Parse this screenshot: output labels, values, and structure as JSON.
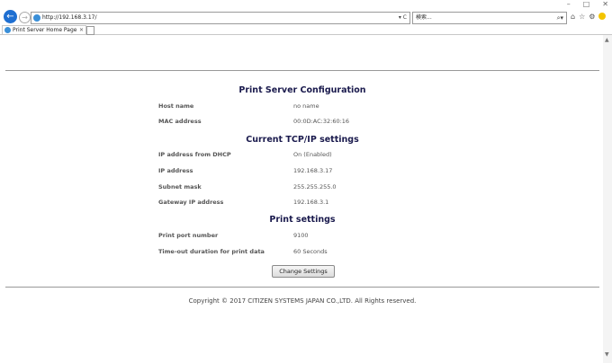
{
  "browser": {
    "window_controls": [
      "–",
      "□",
      "✕"
    ],
    "back_glyph": "←",
    "forward_glyph": "→",
    "url": "http://192.168.3.17/",
    "addr_tools": "▾ C",
    "search_placeholder": "検索...",
    "search_glyph": "⌕▾",
    "tab_title": "Print Server Home Page",
    "tab_close": "✕",
    "right_icons": [
      "⌂",
      "☆",
      "⚙"
    ]
  },
  "page": {
    "section1_title": "Print Server Configuration",
    "host_name_label": "Host name",
    "host_name_value": "no name",
    "mac_label": "MAC address",
    "mac_value": "00:0D:AC:32:60:16",
    "section2_title": "Current TCP/IP settings",
    "dhcp_label": "IP address from DHCP",
    "dhcp_value": "On (Enabled)",
    "ip_label": "IP address",
    "ip_value": "192.168.3.17",
    "subnet_label": "Subnet mask",
    "subnet_value": "255.255.255.0",
    "gateway_label": "Gateway IP address",
    "gateway_value": "192.168.3.1",
    "section3_title": "Print settings",
    "port_label": "Print port number",
    "port_value": "9100",
    "timeout_label": "Time-out duration for print data",
    "timeout_value": "60 Seconds",
    "change_button": "Change Settings",
    "copyright": "Copyright © 2017 CITIZEN SYSTEMS JAPAN CO.,LTD. All Rights reserved."
  }
}
